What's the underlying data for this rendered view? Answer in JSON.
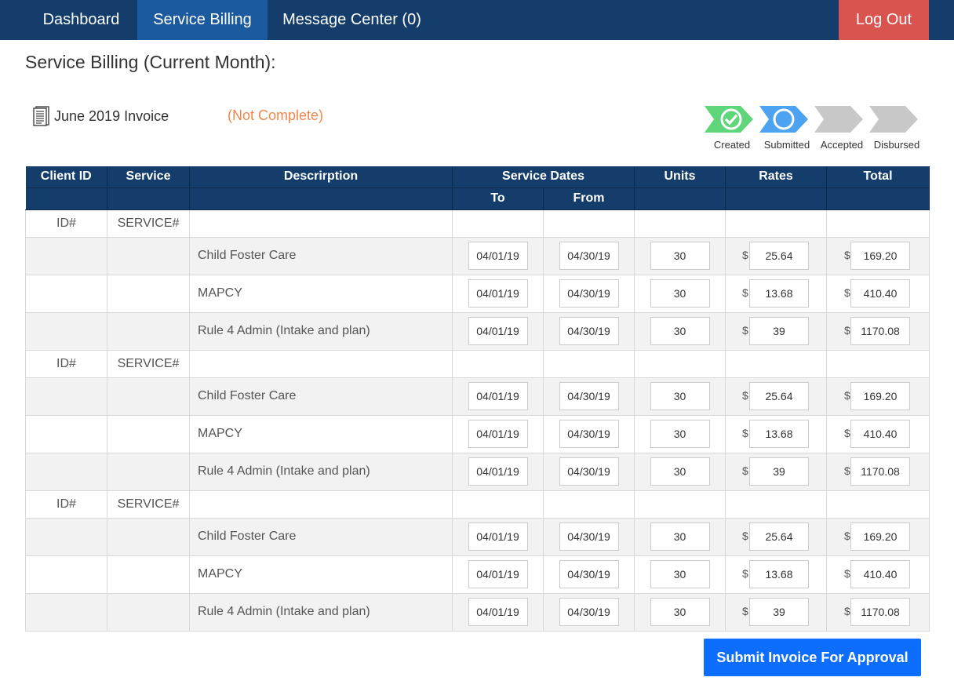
{
  "nav": {
    "items": [
      {
        "label": "Dashboard",
        "active": false
      },
      {
        "label": "Service Billing",
        "active": true
      },
      {
        "label": "Message Center (0)",
        "active": false
      }
    ],
    "logout_label": "Log Out"
  },
  "page": {
    "title": "Service Billing (Current Month):",
    "invoice_label": "June 2019 Invoice",
    "invoice_status": "(Not Complete)"
  },
  "steps": [
    {
      "label": "Created",
      "state": "complete",
      "color": "#5fd67a"
    },
    {
      "label": "Submitted",
      "state": "current",
      "color": "#4da3ef"
    },
    {
      "label": "Accepted",
      "state": "pending",
      "color": "#c8c8c8"
    },
    {
      "label": "Disbursed",
      "state": "pending",
      "color": "#c8c8c8"
    }
  ],
  "table": {
    "headers": {
      "client_id": "Client ID",
      "service": "Service",
      "description": "Descrirption",
      "service_dates": "Service Dates",
      "to": "To",
      "from": "From",
      "units": "Units",
      "rates": "Rates",
      "total": "Total"
    },
    "currency_symbol": "$",
    "groups": [
      {
        "client_id": "ID#",
        "service": "SERVICE#",
        "lines": [
          {
            "description": "Child Foster Care",
            "to": "04/01/19",
            "from": "04/30/19",
            "units": "30",
            "rate": "25.64",
            "total": "169.20"
          },
          {
            "description": "MAPCY",
            "to": "04/01/19",
            "from": "04/30/19",
            "units": "30",
            "rate": "13.68",
            "total": "410.40"
          },
          {
            "description": "Rule 4 Admin (Intake and plan)",
            "to": "04/01/19",
            "from": "04/30/19",
            "units": "30",
            "rate": "39",
            "total": "1170.08"
          }
        ]
      },
      {
        "client_id": "ID#",
        "service": "SERVICE#",
        "lines": [
          {
            "description": "Child Foster Care",
            "to": "04/01/19",
            "from": "04/30/19",
            "units": "30",
            "rate": "25.64",
            "total": "169.20"
          },
          {
            "description": "MAPCY",
            "to": "04/01/19",
            "from": "04/30/19",
            "units": "30",
            "rate": "13.68",
            "total": "410.40"
          },
          {
            "description": "Rule 4 Admin (Intake and plan)",
            "to": "04/01/19",
            "from": "04/30/19",
            "units": "30",
            "rate": "39",
            "total": "1170.08"
          }
        ]
      },
      {
        "client_id": "ID#",
        "service": "SERVICE#",
        "lines": [
          {
            "description": "Child Foster Care",
            "to": "04/01/19",
            "from": "04/30/19",
            "units": "30",
            "rate": "25.64",
            "total": "169.20"
          },
          {
            "description": "MAPCY",
            "to": "04/01/19",
            "from": "04/30/19",
            "units": "30",
            "rate": "13.68",
            "total": "410.40"
          },
          {
            "description": "Rule 4 Admin (Intake and plan)",
            "to": "04/01/19",
            "from": "04/30/19",
            "units": "30",
            "rate": "39",
            "total": "1170.08"
          }
        ]
      }
    ]
  },
  "submit_label": "Submit Invoice For Approval",
  "colors": {
    "nav_bg": "#143d6b",
    "nav_active": "#1c5a9f",
    "logout": "#d9534f",
    "status_orange": "#f0884c",
    "submit_blue": "#0d6efd"
  }
}
